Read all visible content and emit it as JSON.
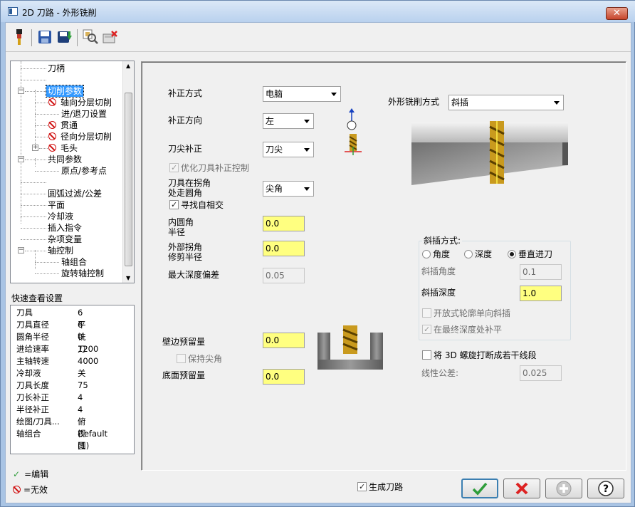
{
  "window": {
    "title": "2D 刀路 - 外形铣削",
    "close_label": "✕"
  },
  "toolbar": {
    "icons": [
      "tool-icon",
      "save-icon",
      "save-as-icon",
      "zoom-tool-icon",
      "delete-icon"
    ]
  },
  "tree": {
    "items": [
      {
        "label": "刀柄"
      },
      {
        "label": ""
      },
      {
        "label": "切削参数"
      },
      {
        "label": "轴向分层切削"
      },
      {
        "label": "进/退刀设置"
      },
      {
        "label": "贯通"
      },
      {
        "label": "径向分层切削"
      },
      {
        "label": "毛头"
      },
      {
        "label": "共同参数"
      },
      {
        "label": "原点/参考点"
      },
      {
        "label": ""
      },
      {
        "label": "圆弧过滤/公差"
      },
      {
        "label": "平面"
      },
      {
        "label": "冷却液"
      },
      {
        "label": "插入指令"
      },
      {
        "label": "杂项变量"
      },
      {
        "label": "轴控制"
      },
      {
        "label": "轴组合"
      },
      {
        "label": "旋转轴控制"
      }
    ]
  },
  "quickview": {
    "label": "快速查看设置",
    "rows": [
      {
        "key": "刀具",
        "value": "6 平铣刀"
      },
      {
        "key": "刀具直径",
        "value": "6"
      },
      {
        "key": "圆角半径",
        "value": "0"
      },
      {
        "key": "进给速率",
        "value": "1200"
      },
      {
        "key": "主轴转速",
        "value": "4000"
      },
      {
        "key": "冷却液",
        "value": "关"
      },
      {
        "key": "刀具长度",
        "value": "75"
      },
      {
        "key": "刀长补正",
        "value": "4"
      },
      {
        "key": "半径补正",
        "value": "4"
      },
      {
        "key": "绘图/刀具...",
        "value": "俯视图"
      },
      {
        "key": "轴组合",
        "value": "Default (1)"
      }
    ]
  },
  "legend": {
    "edit": "=编辑",
    "invalid": "=无效"
  },
  "params": {
    "comp_type_label": "补正方式",
    "comp_type_value": "电脑",
    "comp_dir_label": "补正方向",
    "comp_dir_value": "左",
    "tip_comp_label": "刀尖补正",
    "tip_comp_value": "刀尖",
    "optimize_label": "优化刀具补正控制",
    "corner_label_1": "刀具在拐角",
    "corner_label_2": "处走圆角",
    "corner_value": "尖角",
    "find_intersect_label": "寻找自相交",
    "inner_radius_label_1": "内圆角",
    "inner_radius_label_2": "半径",
    "inner_radius_value": "0.0",
    "outer_trim_label_1": "外部拐角",
    "outer_trim_label_2": "修剪半径",
    "outer_trim_value": "0.0",
    "max_depth_label": "最大深度偏差",
    "max_depth_value": "0.05",
    "wall_stock_label": "壁边预留量",
    "wall_stock_value": "0.0",
    "keep_sharp_label": "保持尖角",
    "floor_stock_label": "底面预留量",
    "floor_stock_value": "0.0",
    "contour_type_label": "外形铣削方式",
    "contour_type_value": "斜插",
    "ramp_group_label": "斜插方式:",
    "ramp_angle_radio": "角度",
    "ramp_depth_radio": "深度",
    "ramp_vertical_radio": "垂直进刀",
    "ramp_angle_label": "斜插角度",
    "ramp_angle_value": "0.1",
    "ramp_depth_label": "斜插深度",
    "ramp_depth_value": "1.0",
    "open_contour_label": "开放式轮廓单向斜插",
    "final_depth_label": "在最终深度处补平",
    "helix_label": "将 3D 螺旋打断成若干线段",
    "linear_tol_label": "线性公差:",
    "linear_tol_value": "0.025"
  },
  "bottom": {
    "generate_label": "生成刀路"
  },
  "colors": {
    "field_yellow": "#ffff80",
    "title_blue": "#b9d1ee"
  }
}
